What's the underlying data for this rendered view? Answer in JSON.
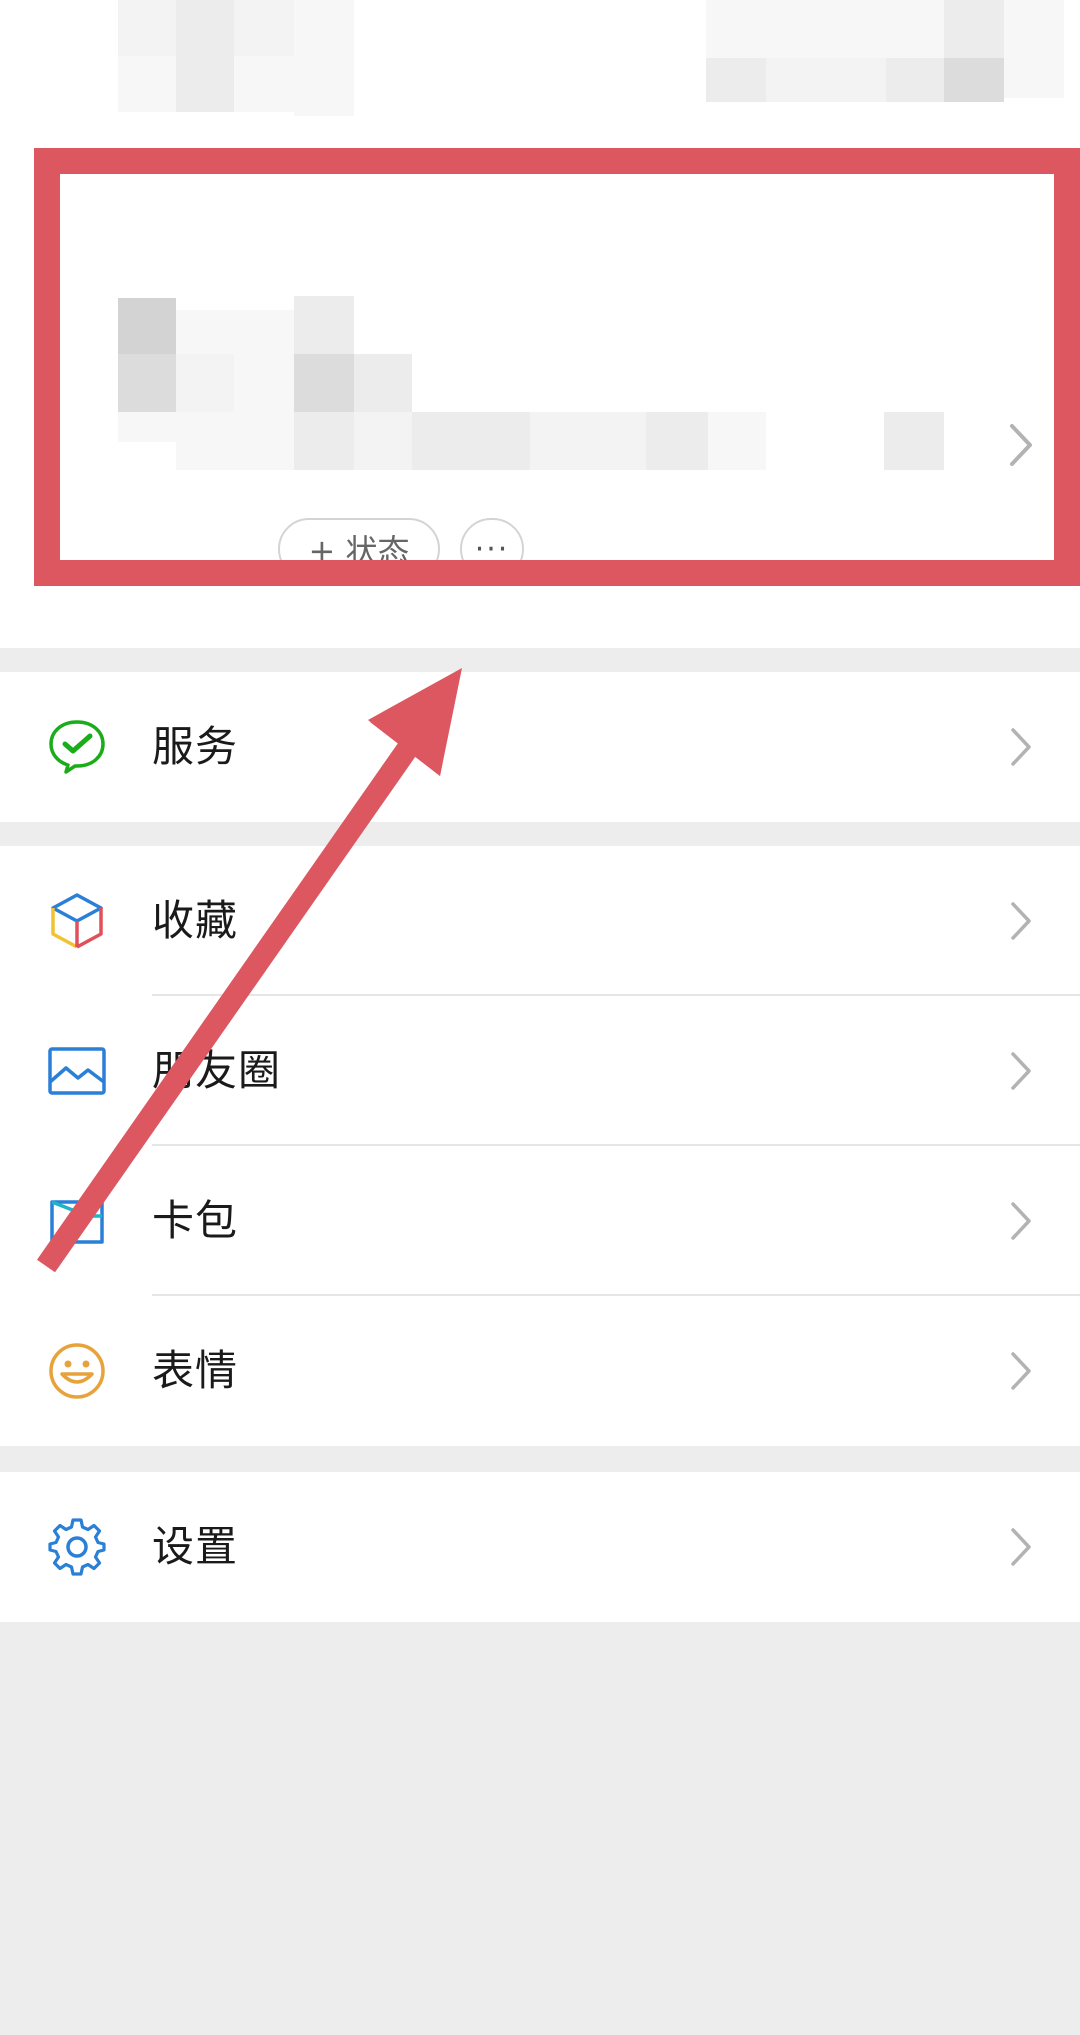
{
  "profile": {
    "status_button_label": "+ 状态",
    "more_button_label": "···"
  },
  "menu": {
    "services": {
      "label": "服务",
      "icon": "wechat-pay-check-icon"
    },
    "favorites": {
      "label": "收藏",
      "icon": "cube-icon"
    },
    "moments": {
      "label": "朋友圈",
      "icon": "photo-icon"
    },
    "cards": {
      "label": "卡包",
      "icon": "card-wallet-icon"
    },
    "stickers": {
      "label": "表情",
      "icon": "smiley-icon"
    },
    "settings": {
      "label": "设置",
      "icon": "gear-icon"
    }
  },
  "colors": {
    "annotation_red": "#dd5760",
    "background_gray": "#ededed",
    "service_green": "#1aad19",
    "icon_blue": "#2a7fd6",
    "sticker_orange": "#e8a23a"
  }
}
